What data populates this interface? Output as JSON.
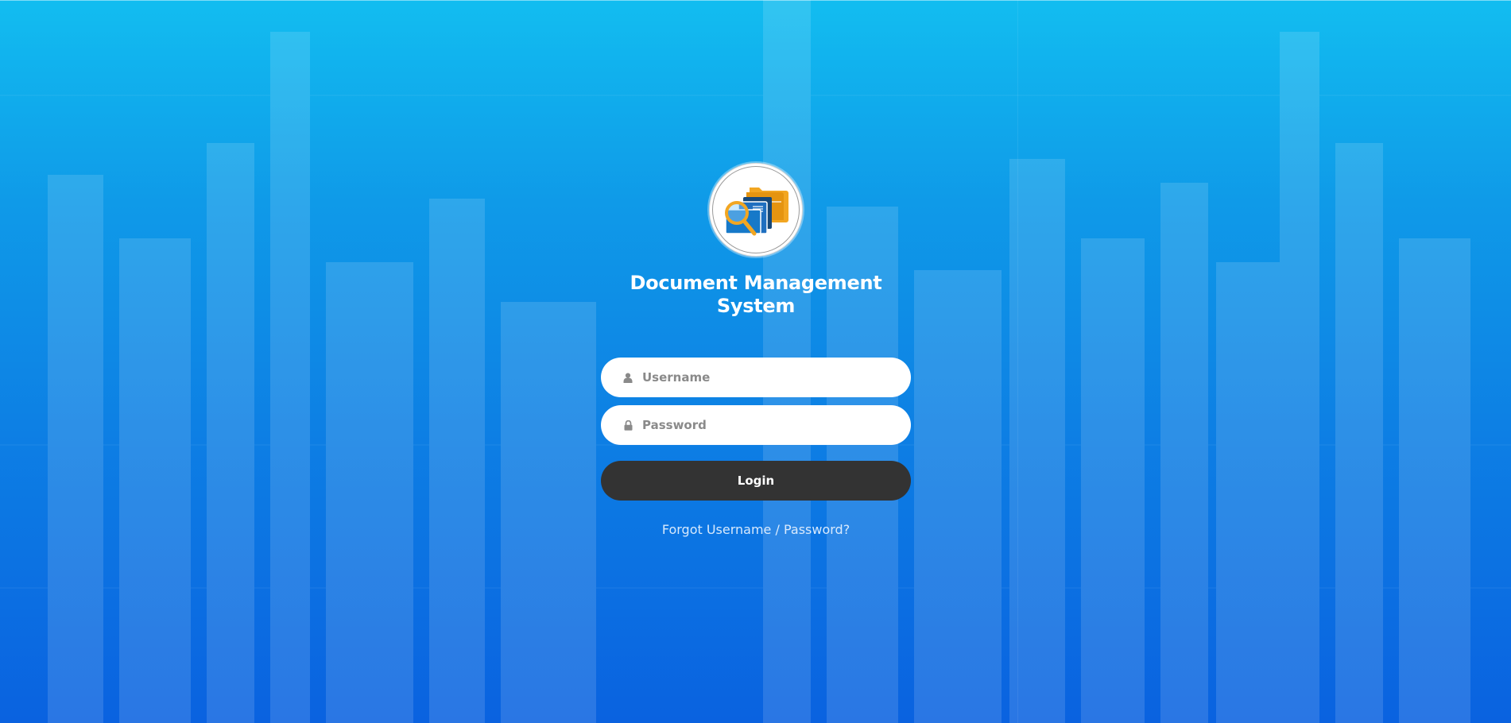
{
  "app": {
    "title": "Document Management System",
    "logo_icon": "document-search-icon"
  },
  "form": {
    "username_placeholder": "Username",
    "username_value": "",
    "username_icon": "user-icon",
    "password_placeholder": "Password",
    "password_value": "",
    "password_icon": "lock-icon",
    "login_label": "Login",
    "forgot_link": "Forgot Username / Password?"
  },
  "colors": {
    "background_top": "#12bdf0",
    "background_bottom": "#0a62e0",
    "button": "#333333",
    "field": "#ffffff",
    "logo_folder": "#f2a622",
    "logo_doc": "#1f6fc0"
  }
}
